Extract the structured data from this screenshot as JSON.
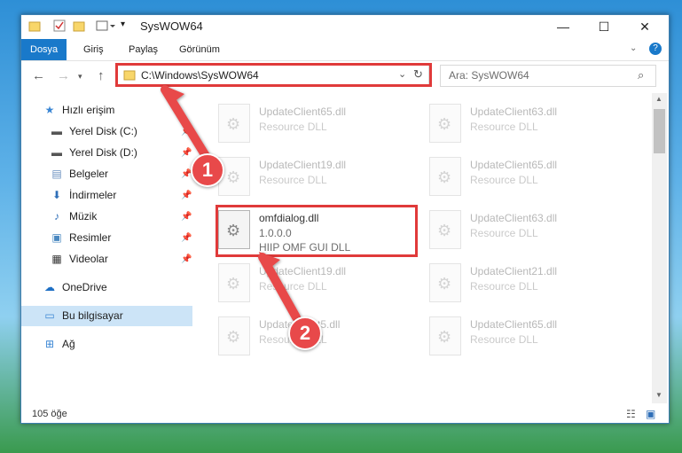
{
  "window": {
    "title": "SysWOW64",
    "controls": {
      "minimize": "—",
      "maximize": "☐",
      "close": "✕"
    }
  },
  "ribbon": {
    "tabs": [
      "Dosya",
      "Giriş",
      "Paylaş",
      "Görünüm"
    ],
    "active_tab": "Dosya",
    "help": "?"
  },
  "nav": {
    "address": "C:\\Windows\\SysWOW64",
    "search_placeholder": "Ara: SysWOW64"
  },
  "sidebar": {
    "items": [
      {
        "label": "Hızlı erişim",
        "icon": "star-icon",
        "pinned": false
      },
      {
        "label": "Yerel Disk (C:)",
        "icon": "drive-icon",
        "pinned": true
      },
      {
        "label": "Yerel Disk (D:)",
        "icon": "drive-icon",
        "pinned": true
      },
      {
        "label": "Belgeler",
        "icon": "document-icon",
        "pinned": true
      },
      {
        "label": "İndirmeler",
        "icon": "download-icon",
        "pinned": true
      },
      {
        "label": "Müzik",
        "icon": "music-icon",
        "pinned": true
      },
      {
        "label": "Resimler",
        "icon": "pictures-icon",
        "pinned": true
      },
      {
        "label": "Videolar",
        "icon": "video-icon",
        "pinned": true
      },
      {
        "label": "OneDrive",
        "icon": "cloud-icon",
        "pinned": false
      },
      {
        "label": "Bu bilgisayar",
        "icon": "computer-icon",
        "pinned": false,
        "selected": true
      },
      {
        "label": "Ağ",
        "icon": "network-icon",
        "pinned": false
      }
    ]
  },
  "files": [
    {
      "name": "UpdateClient65.dll",
      "desc": "Resource DLL"
    },
    {
      "name": "UpdateClient63.dll",
      "desc": "Resource DLL"
    },
    {
      "name": "UpdateClient19.dll",
      "desc": "Resource DLL"
    },
    {
      "name": "UpdateClient65.dll",
      "desc": "Resource DLL"
    },
    {
      "name": "omfdialog.dll",
      "version": "1.0.0.0",
      "desc": "HIIP OMF GUI DLL"
    },
    {
      "name": "UpdateClient63.dll",
      "desc": "Resource DLL"
    },
    {
      "name": "UpdateClient19.dll",
      "desc": "Resource DLL"
    },
    {
      "name": "UpdateClient21.dll",
      "desc": "Resource DLL"
    },
    {
      "name": "UpdateClient5.dll",
      "desc": "Resource DLL"
    },
    {
      "name": "UpdateClient65.dll",
      "desc": "Resource DLL"
    }
  ],
  "status": {
    "count": "105 öğe"
  },
  "annotations": {
    "step1": "1",
    "step2": "2",
    "color": "#e03a3a"
  }
}
